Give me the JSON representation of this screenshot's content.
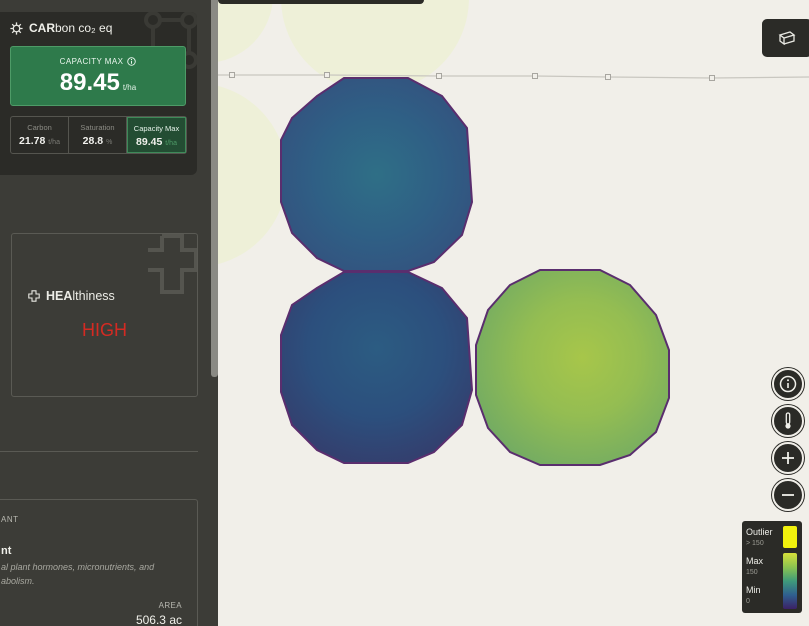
{
  "carbon": {
    "title_bold": "CAR",
    "title_rest": "bon co₂ eq",
    "capacity_label": "CAPACITY MAX",
    "capacity_value": "89.45",
    "capacity_unit": "t/ha",
    "stats": [
      {
        "label": "Carbon",
        "value": "21.78",
        "unit": "t/ha"
      },
      {
        "label": "Saturation",
        "value": "28.8",
        "unit": "%"
      },
      {
        "label": "Capacity Max",
        "value": "89.45",
        "unit": "t/ha"
      }
    ]
  },
  "health": {
    "title_bold": "HEA",
    "title_rest": "lthiness",
    "value": "HIGH"
  },
  "plant": {
    "type_label": "ANT",
    "name": "nt",
    "description": "al plant hormones, micronutrients, and abolism.",
    "area_label": "AREA",
    "area_value": "506.3 ac"
  },
  "legend": {
    "outlier_label": "Outlier",
    "outlier_sub": "> 150",
    "max_label": "Max",
    "max_sub": "150",
    "min_label": "Min",
    "min_sub": "0",
    "outlier_color": "#f2f20d",
    "gradient": [
      "#d7e03a",
      "#8cc450",
      "#3f9a7a",
      "#2f5f8e",
      "#3b2166"
    ]
  },
  "controls": [
    "info-icon",
    "thermometer-icon",
    "plus-icon",
    "minus-icon",
    "layers-icon"
  ],
  "colors": {
    "sidebar": "#3c3c37",
    "card": "#2b2b27",
    "accent_green": "#2e7a4b",
    "health_high": "#d42a22",
    "map_bg": "#f1efe9",
    "field_outline": "#5a2e6e"
  }
}
